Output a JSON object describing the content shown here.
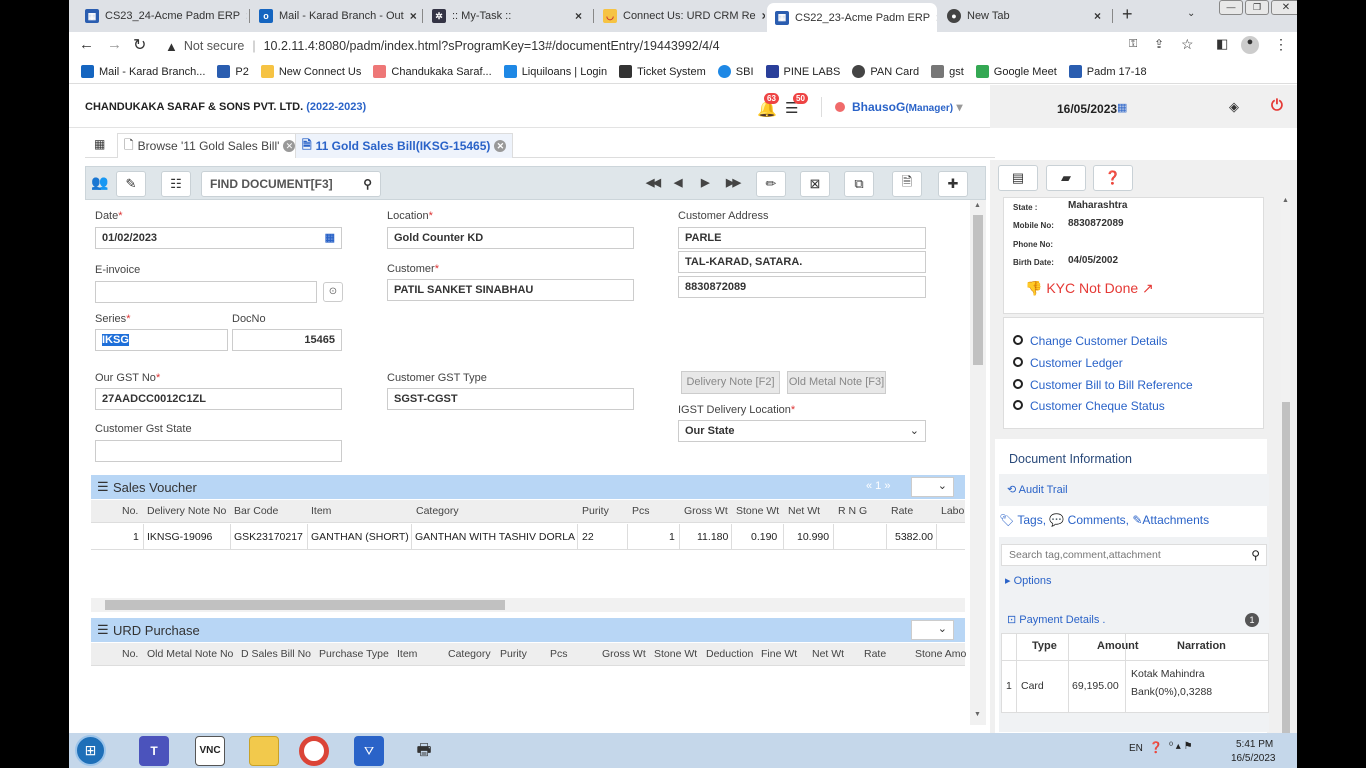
{
  "browser": {
    "tabs": [
      {
        "title": "CS23_24-Acme Padm ERP",
        "close": "×"
      },
      {
        "title": "Mail - Karad Branch - Out",
        "close": "×"
      },
      {
        "title": ":: My-Task ::",
        "close": "×"
      },
      {
        "title": "Connect Us: URD CRM Re",
        "close": "×"
      },
      {
        "title": "CS22_23-Acme Padm ERP",
        "close": "×"
      },
      {
        "title": "New Tab",
        "close": "×"
      }
    ],
    "new_tab": "+",
    "address_security": "Not secure",
    "address_url": "10.2.11.4:8080/padm/index.html?sProgramKey=13#/documentEntry/19443992/4/4",
    "bookmarks": [
      "Mail - Karad Branch...",
      "P2",
      "New Connect Us",
      "Chandukaka Saraf...",
      "Liquiloans | Login",
      "Ticket System",
      "SBI",
      "PINE LABS",
      "PAN Card",
      "gst",
      "Google Meet",
      "Padm 17-18"
    ]
  },
  "app": {
    "company": "CHANDUKAKA SARAF & SONS PVT. LTD.",
    "year": "(2022-2023)",
    "notif_count": "63",
    "msg_count": "50",
    "user": "BhausoG",
    "role": "(Manager)",
    "date": "16/05/2023"
  },
  "doc_tabs": [
    {
      "label": "Browse '11 Gold Sales Bill'"
    },
    {
      "label": "11 Gold Sales Bill(IKSG-15465)"
    }
  ],
  "toolbar": {
    "find_placeholder": "FIND DOCUMENT[F3]"
  },
  "form": {
    "date_label": "Date",
    "date_value": "01/02/2023",
    "einvoice_label": "E-invoice",
    "series_label": "Series",
    "series_value": "IKSG",
    "docno_label": "DocNo",
    "docno_value": "15465",
    "gst_label": "Our GST No",
    "gst_value": "27AADCC0012C1ZL",
    "cust_gst_state_label": "Customer Gst State",
    "location_label": "Location",
    "location_value": "Gold Counter KD",
    "customer_label": "Customer",
    "customer_value": "PATIL SANKET SINABHAU",
    "cust_gst_type_label": "Customer GST Type",
    "cust_gst_type_value": "SGST-CGST",
    "address_label": "Customer Address",
    "address_1": "PARLE",
    "address_2": "TAL-KARAD, SATARA.",
    "address_3": "8830872089",
    "delivery_note_btn": "Delivery Note [F2]",
    "old_metal_btn": "Old Metal Note [F3]",
    "igst_label": "IGST Delivery Location",
    "igst_value": "Our State"
  },
  "sales_voucher": {
    "title": "Sales Voucher",
    "pager": "« 1 »",
    "columns": [
      "No.",
      "Delivery Note No",
      "Bar Code",
      "Item",
      "Category",
      "Purity",
      "Pcs",
      "Gross Wt",
      "Stone Wt",
      "Net Wt",
      "R N G",
      "Rate",
      "Labo"
    ],
    "row": [
      "1",
      "IKNSG-19096",
      "GSK23170217",
      "GANTHAN (SHORT)",
      "GANTHAN WITH TASHIV DORLA",
      "22",
      "1",
      "11.180",
      "0.190",
      "10.990",
      "",
      "5382.00"
    ]
  },
  "urd_purchase": {
    "title": "URD Purchase",
    "columns": [
      "No.",
      "Old Metal Note No",
      "D Sales Bill No",
      "Purchase Type",
      "Item",
      "Category",
      "Purity",
      "Pcs",
      "Gross Wt",
      "Stone Wt",
      "Deduction",
      "Fine Wt",
      "Net Wt",
      "Rate",
      "Stone Amo"
    ]
  },
  "right_panel": {
    "state_label": "State :",
    "state_value": "Maharashtra",
    "mobile_label": "Mobile No:",
    "mobile_value": "8830872089",
    "phone_label": "Phone No:",
    "birth_label": "Birth Date:",
    "birth_value": "04/05/2002",
    "kyc": "KYC Not Done",
    "links": [
      "Change Customer Details",
      "Customer Ledger",
      "Customer Bill to Bill Reference",
      "Customer Cheque Status"
    ],
    "doc_info": "Document Information",
    "audit_trail": "Audit Trail",
    "tags": "Tags,",
    "comments": "Comments,",
    "attachments": "Attachments",
    "search_placeholder": "Search tag,comment,attachment",
    "options": "Options",
    "payment_title": "Payment Details .",
    "payment_count": "1",
    "payment_cols": [
      "Type",
      "Amount",
      "Narration"
    ],
    "payment_row": {
      "no": "1",
      "type": "Card",
      "amount": "69,195.00",
      "narr1": "Kotak Mahindra",
      "narr2": "Bank(0%),0,3288"
    }
  },
  "taskbar": {
    "lang": "EN",
    "time": "5:41 PM",
    "date": "16/5/2023"
  },
  "colors": {
    "accent": "#2a63c8",
    "grid_header": "#b8d6f5",
    "danger": "#e53935"
  }
}
